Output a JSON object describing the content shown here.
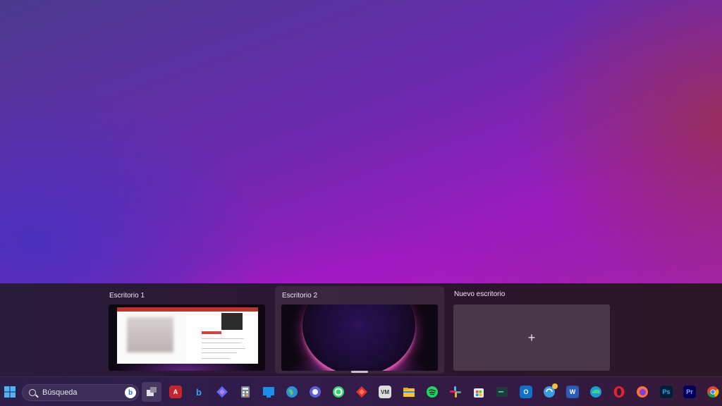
{
  "taskview": {
    "desktops": [
      {
        "label": "Escritorio 1"
      },
      {
        "label": "Escritorio 2"
      },
      {
        "label": "Nuevo escritorio"
      }
    ],
    "new_desktop_symbol": "+"
  },
  "taskbar": {
    "search_placeholder": "Búsqueda",
    "bing_label": "b",
    "apps": [
      {
        "name": "start-icon"
      },
      {
        "name": "task-view-icon"
      },
      {
        "name": "access-icon",
        "text": "A"
      },
      {
        "name": "bing-icon",
        "text": "b"
      },
      {
        "name": "copilot-icon"
      },
      {
        "name": "calculator-icon"
      },
      {
        "name": "widgets-icon"
      },
      {
        "name": "earth-browser-icon"
      },
      {
        "name": "torrent-icon"
      },
      {
        "name": "whatsapp-icon"
      },
      {
        "name": "anydesk-icon"
      },
      {
        "name": "vm-icon",
        "text": "VM"
      },
      {
        "name": "file-explorer-icon"
      },
      {
        "name": "spotify-icon"
      },
      {
        "name": "slack-icon"
      },
      {
        "name": "store-icon"
      },
      {
        "name": "terminal-icon"
      },
      {
        "name": "outlook-icon",
        "text": "O"
      },
      {
        "name": "update-icon"
      },
      {
        "name": "word-icon",
        "text": "W"
      },
      {
        "name": "edge-icon"
      },
      {
        "name": "opera-icon"
      },
      {
        "name": "firefox-icon"
      },
      {
        "name": "photoshop-icon",
        "text": "Ps"
      },
      {
        "name": "premiere-icon",
        "text": "Pr"
      },
      {
        "name": "chrome-icon"
      }
    ]
  },
  "colors": {
    "taskbar_bg": "#2f1c49",
    "accent": "#a21cc4"
  }
}
